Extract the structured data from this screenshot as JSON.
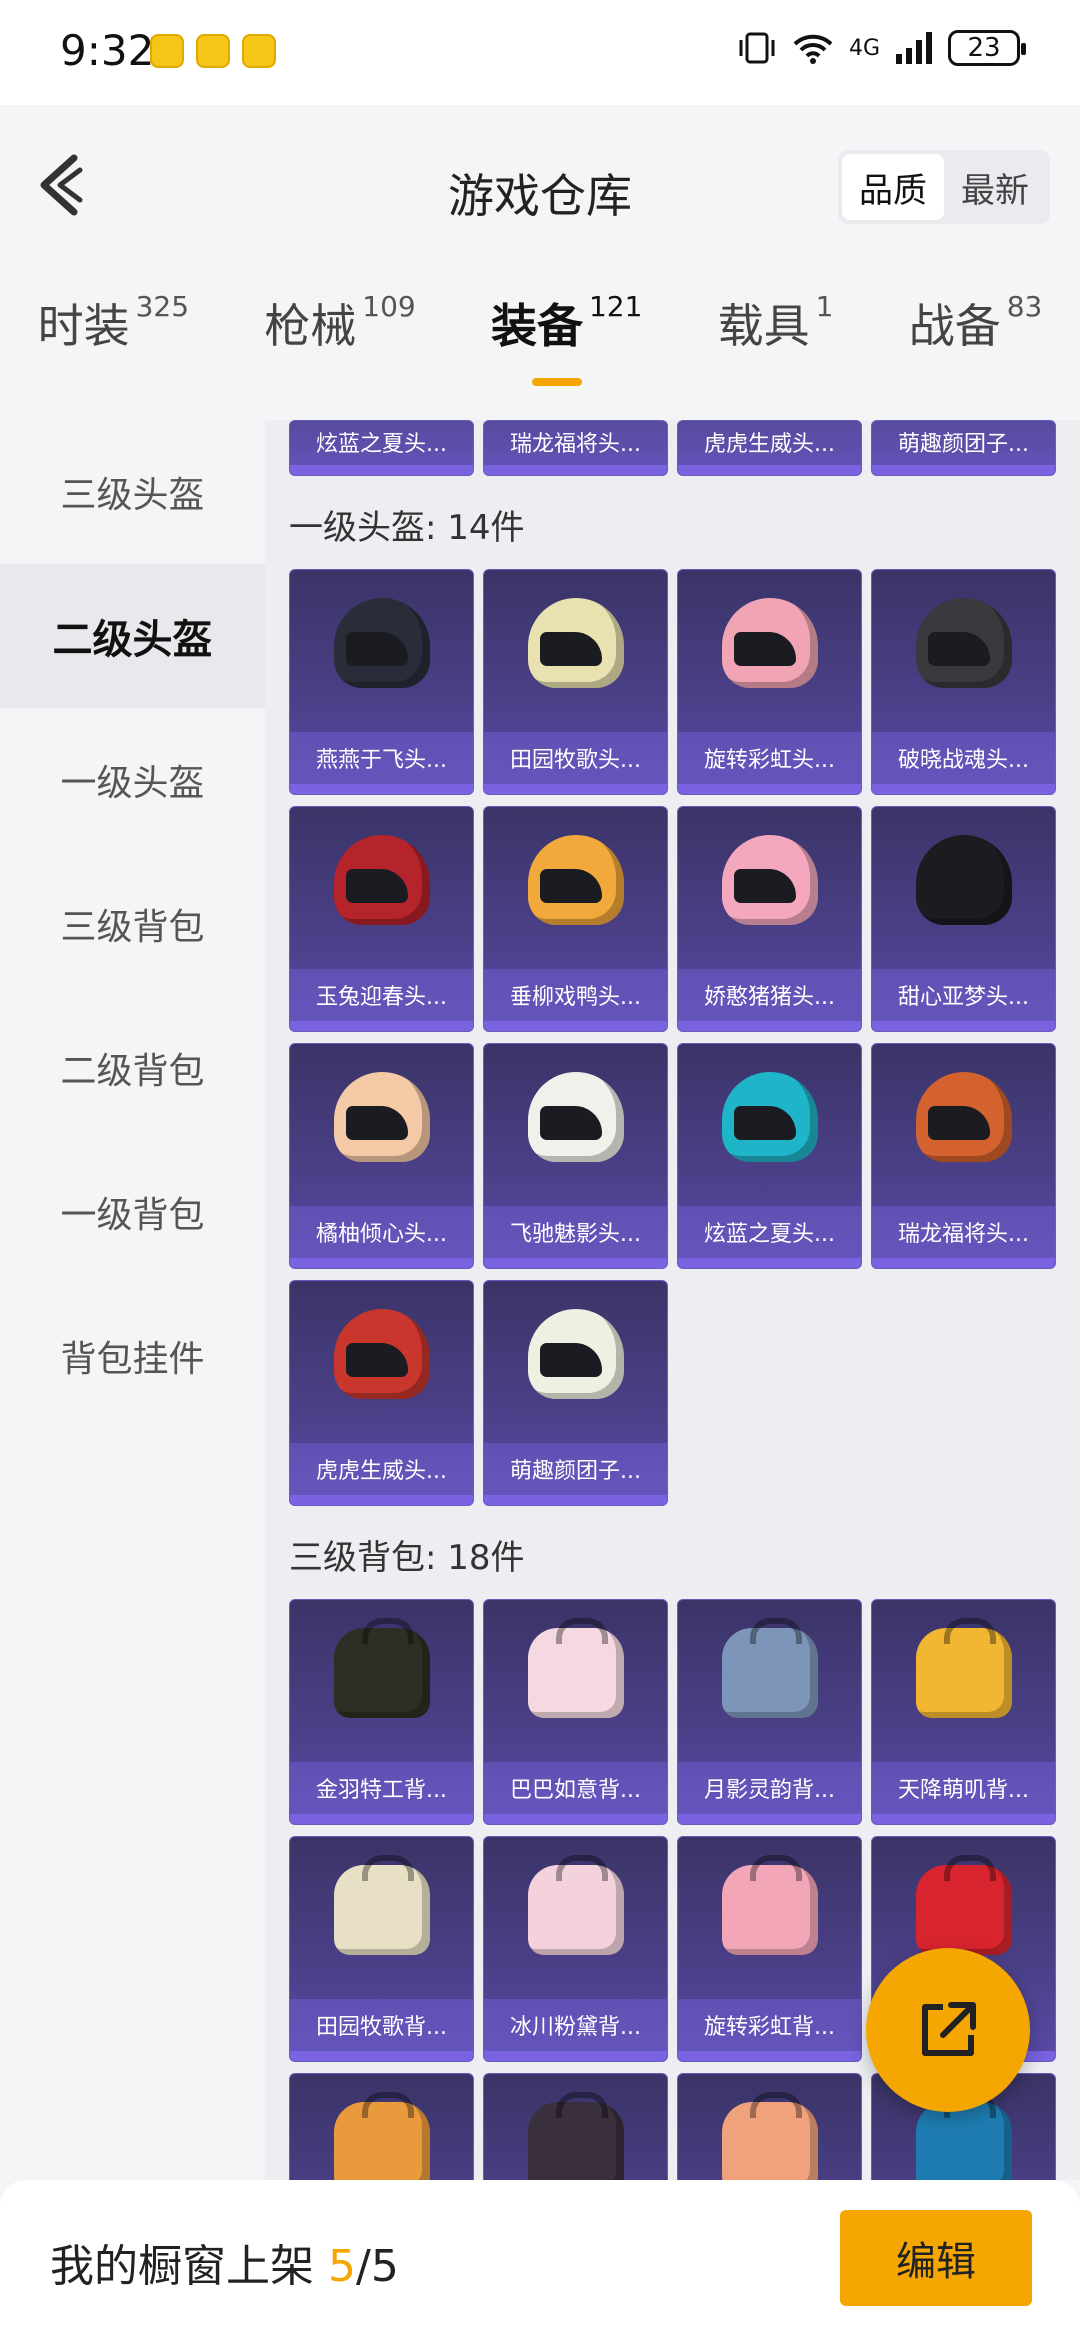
{
  "status_bar": {
    "time": "9:32",
    "battery": "23",
    "network": "4G"
  },
  "header": {
    "title": "游戏仓库",
    "sort": [
      "品质",
      "最新"
    ],
    "sort_active": "品质"
  },
  "tabs": [
    {
      "label": "时装",
      "count": "325"
    },
    {
      "label": "枪械",
      "count": "109"
    },
    {
      "label": "装备",
      "count": "121"
    },
    {
      "label": "载具",
      "count": "1"
    },
    {
      "label": "战备",
      "count": "83"
    }
  ],
  "sidebar": [
    "三级头盔",
    "二级头盔",
    "一级头盔",
    "三级背包",
    "二级背包",
    "一级背包",
    "背包挂件"
  ],
  "partial_row": [
    "炫蓝之夏头...",
    "瑞龙福将头...",
    "虎虎生威头...",
    "萌趣颜团子..."
  ],
  "sections": [
    {
      "title": "一级头盔: 14件",
      "items": [
        {
          "name": "燕燕于飞头...",
          "color": "#2a2c3a"
        },
        {
          "name": "田园牧歌头...",
          "color": "#e9e2b0"
        },
        {
          "name": "旋转彩虹头...",
          "color": "#f0a4b4"
        },
        {
          "name": "破晓战魂头...",
          "color": "#3a3a3e"
        },
        {
          "name": "玉兔迎春头...",
          "color": "#b5232b"
        },
        {
          "name": "垂柳戏鸭头...",
          "color": "#f2a93c"
        },
        {
          "name": "娇憨猪猪头...",
          "color": "#f3a8be"
        },
        {
          "name": "甜心亚梦头...",
          "color": "#1d1b20"
        },
        {
          "name": "橘柚倾心头...",
          "color": "#f4c9a6"
        },
        {
          "name": "飞驰魅影头...",
          "color": "#f2f0ea"
        },
        {
          "name": "炫蓝之夏头...",
          "color": "#1fb5c8"
        },
        {
          "name": "瑞龙福将头...",
          "color": "#d4622e"
        },
        {
          "name": "虎虎生威头...",
          "color": "#c9362e"
        },
        {
          "name": "萌趣颜团子...",
          "color": "#eef0e2"
        }
      ]
    },
    {
      "title": "三级背包: 18件",
      "items": [
        {
          "name": "金羽特工背...",
          "color": "#2c2f24"
        },
        {
          "name": "巴巴如意背...",
          "color": "#f6d9e0"
        },
        {
          "name": "月影灵韵背...",
          "color": "#7c95b8"
        },
        {
          "name": "天降萌叽背...",
          "color": "#f2b632"
        },
        {
          "name": "田园牧歌背...",
          "color": "#e8e0c4"
        },
        {
          "name": "冰川粉黛背...",
          "color": "#f4d2dc"
        },
        {
          "name": "旋转彩虹背...",
          "color": "#f2a6b8"
        },
        {
          "name": "",
          "color": "#d8242e"
        },
        {
          "name": "",
          "color": "#e89a3c"
        },
        {
          "name": "",
          "color": "#3a2f3c"
        },
        {
          "name": "",
          "color": "#f0a27c"
        },
        {
          "name": "",
          "color": "#1e7cb2"
        }
      ]
    }
  ],
  "bottom_bar": {
    "label_prefix": "我的橱窗上架 ",
    "current": "5",
    "total": "/5",
    "edit_label": "编辑"
  },
  "icons": {
    "back": "chevron-left-icon",
    "share": "share-external-icon"
  },
  "colors": {
    "accent": "#f5a600",
    "card_bg": "#4a3f86"
  }
}
